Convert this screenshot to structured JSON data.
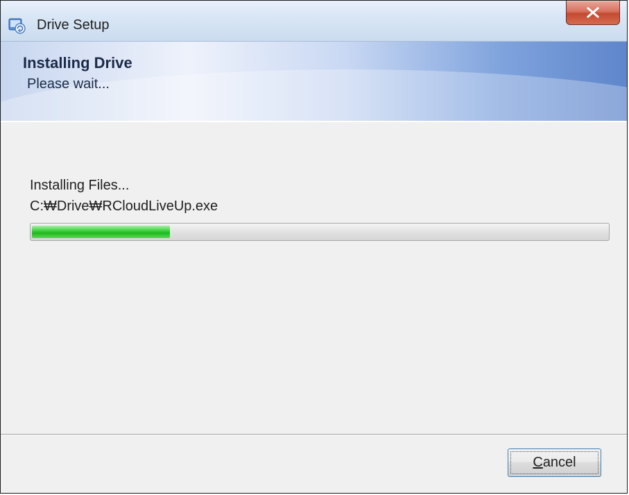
{
  "window": {
    "title": "Drive Setup",
    "app_icon": "installer-icon",
    "close_icon": "close-x-icon",
    "close_color": "#c44a32"
  },
  "banner": {
    "title": "Installing Drive",
    "subtitle": "Please wait..."
  },
  "status": {
    "line1": "Installing Files...",
    "line2": "C:₩Drive₩RCloudLiveUp.exe"
  },
  "progress": {
    "percent": 24,
    "color": "#2ec42e"
  },
  "footer": {
    "cancel_mnemonic": "C",
    "cancel_rest": "ancel"
  }
}
